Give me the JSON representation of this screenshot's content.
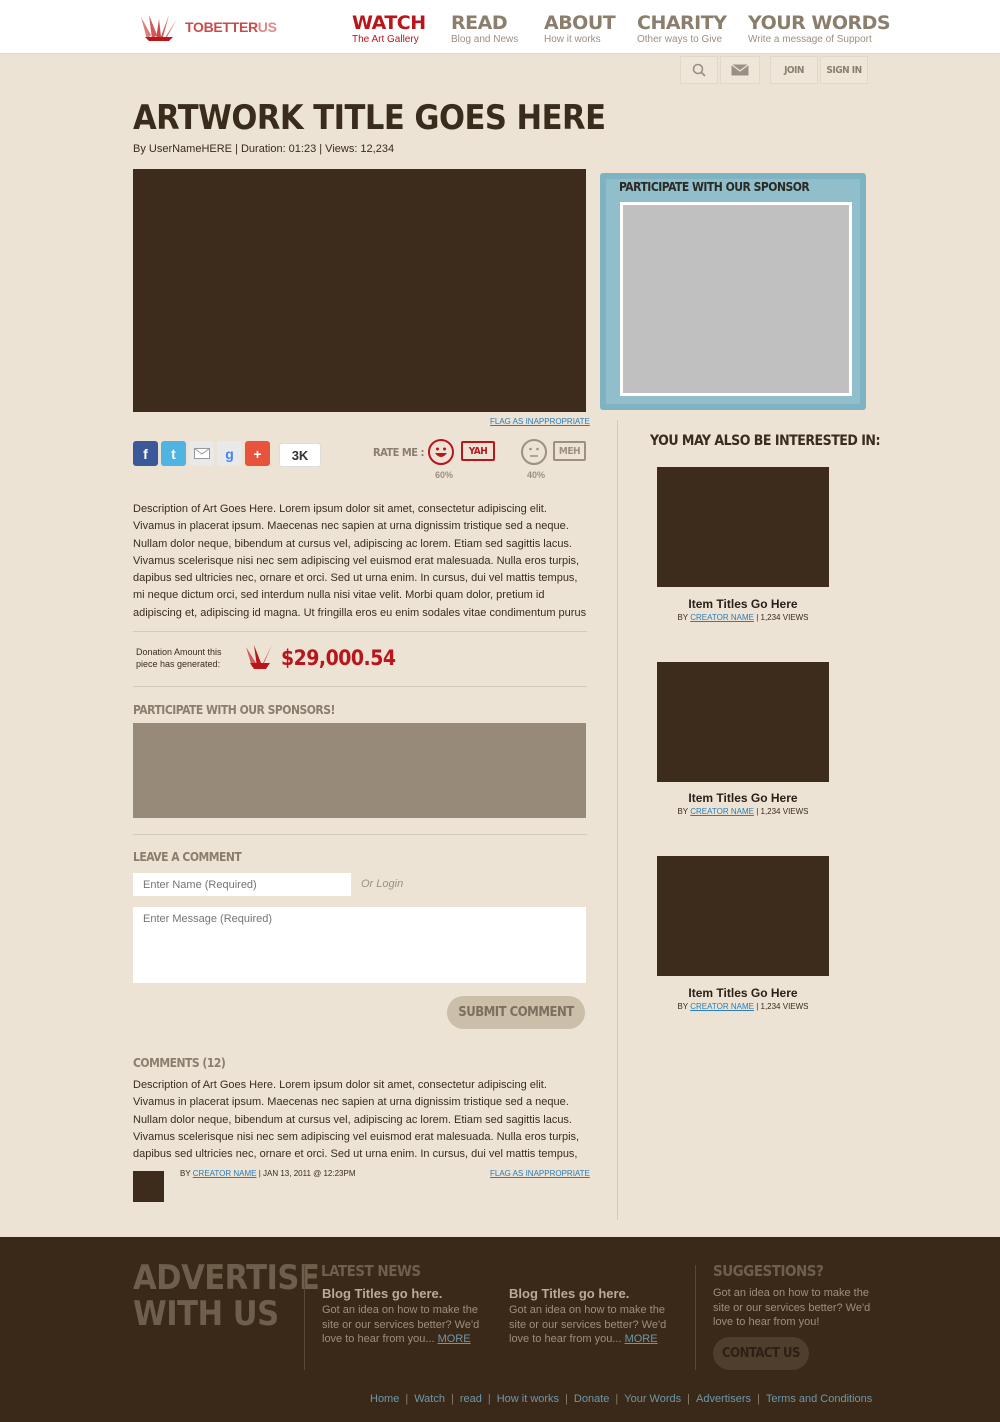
{
  "logo": {
    "text_a": "TOBETTER",
    "text_b": "US"
  },
  "nav": [
    {
      "title": "WATCH",
      "sub": "The Art Gallery"
    },
    {
      "title": "READ",
      "sub": "Blog and News"
    },
    {
      "title": "ABOUT",
      "sub": "How it works"
    },
    {
      "title": "CHARITY",
      "sub": "Other ways to Give"
    },
    {
      "title": "YOUR WORDS",
      "sub": "Write a message of Support"
    }
  ],
  "utility": {
    "join": "JOIN",
    "signin": "SIGN IN"
  },
  "artwork": {
    "title": "ARTWORK TITLE GOES HERE",
    "byline": "By UserNameHERE  |  Duration: 01:23  |  Views: 12,234",
    "flag": "FLAG AS INAPPROPRIATE",
    "description": "Description of Art Goes Here. Lorem ipsum dolor sit amet, consectetur adipiscing elit. Vivamus in placerat ipsum. Maecenas nec sapien at urna dignissim tristique sed a neque. Nullam dolor neque, bibendum at cursus vel, adipiscing ac lorem. Etiam sed sagittis lacus. Vivamus scelerisque nisi nec sem adipiscing vel euismod erat malesuada. Nulla eros turpis, dapibus sed ultricies nec, ornare et orci. Sed ut urna enim. In cursus, dui vel mattis tempus, mi neque dictum orci, sed interdum nulla nisi vitae velit. Morbi quam dolor, pretium id adipiscing et, adipiscing id magna. Ut fringilla eros eu enim sodales vitae condimentum purus"
  },
  "share": {
    "count": "3K"
  },
  "rating": {
    "label": "RATE ME :",
    "yah": "YAH",
    "yah_pct": "60%",
    "meh": "MEH",
    "meh_pct": "40%"
  },
  "donation": {
    "label": "Donation Amount this piece has generated:",
    "amount": "$29,000.54"
  },
  "sponsor": {
    "side_label": "PARTICIPATE WITH OUR SPONSOR",
    "main_label": "PARTICIPATE WITH OUR SPONSORS!"
  },
  "comment_form": {
    "title": "LEAVE A COMMENT",
    "name_placeholder": "Enter Name (Required)",
    "or_login": "Or Login",
    "message_placeholder": "Enter Message (Required)",
    "submit": "SUBMIT COMMENT"
  },
  "comments": {
    "title": "COMMENTS (12)",
    "items": [
      {
        "text": "Description of Art Goes Here. Lorem ipsum dolor sit amet, consectetur adipiscing elit. Vivamus in placerat ipsum. Maecenas nec sapien at urna dignissim tristique sed a neque. Nullam dolor neque, bibendum at cursus vel, adipiscing ac lorem. Etiam sed sagittis lacus. Vivamus scelerisque nisi nec sem adipiscing vel euismod erat malesuada. Nulla eros turpis, dapibus sed ultricies nec, ornare et orci. Sed ut urna enim. In cursus, dui vel mattis tempus,",
        "by": "BY",
        "author": "CREATOR NAME",
        "date": "|  JAN 13, 2011 @ 12:23PM",
        "flag": "FLAG AS INAPPROPRIATE"
      }
    ]
  },
  "interested": {
    "title": "YOU MAY ALSO BE INTERESTED IN:",
    "items": [
      {
        "title": "Item Titles Go Here",
        "by": "BY",
        "author": "CREATOR NAME",
        "views": "|  1,234 VIEWS"
      },
      {
        "title": "Item Titles Go Here",
        "by": "BY",
        "author": "CREATOR NAME",
        "views": "|  1,234 VIEWS"
      },
      {
        "title": "Item Titles Go Here",
        "by": "BY",
        "author": "CREATOR NAME",
        "views": "|  1,234 VIEWS"
      }
    ]
  },
  "footer": {
    "advertise": "ADVERTISE WITH US",
    "news_title": "LATEST NEWS",
    "blogs": [
      {
        "title": "Blog Titles go here.",
        "text": "Got an idea on how to make the site or our services better? We'd love to hear from you...",
        "more": "MORE"
      },
      {
        "title": "Blog Titles go here.",
        "text": "Got an idea on how to make the site or our services better? We'd love to hear from you...",
        "more": "MORE"
      }
    ],
    "suggest_title": "SUGGESTIONS?",
    "suggest_text": "Got an idea on how to make the site or our services better? We'd love to hear from you!",
    "contact": "CONTACT US",
    "links": [
      "Home",
      "Watch",
      "read",
      "How it works",
      "Donate",
      "Your Words",
      "Advertisers",
      "Terms and Conditions"
    ]
  }
}
